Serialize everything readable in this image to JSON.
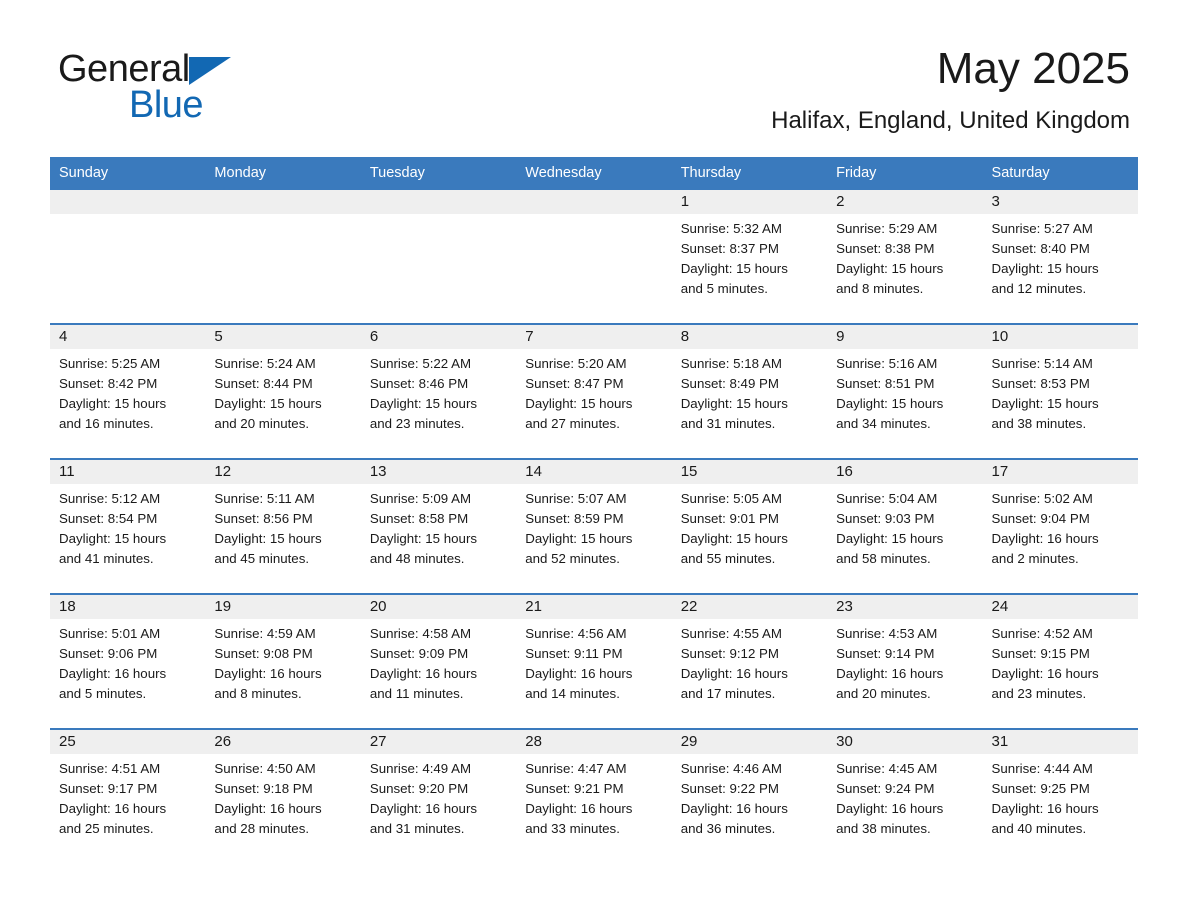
{
  "brand": {
    "name_part1": "General",
    "name_part2": "Blue",
    "accent_color": "#1268b3"
  },
  "header": {
    "month_title": "May 2025",
    "location": "Halifax, England, United Kingdom",
    "header_bg_color": "#3a7abd"
  },
  "labels": {
    "sunrise_prefix": "Sunrise:",
    "sunset_prefix": "Sunset:",
    "daylight_prefix": "Daylight:"
  },
  "weekdays": [
    "Sunday",
    "Monday",
    "Tuesday",
    "Wednesday",
    "Thursday",
    "Friday",
    "Saturday"
  ],
  "weeks": [
    [
      {
        "day": "",
        "sunrise": "",
        "sunset": "",
        "daylight_l1": "",
        "daylight_l2": "",
        "empty": true
      },
      {
        "day": "",
        "sunrise": "",
        "sunset": "",
        "daylight_l1": "",
        "daylight_l2": "",
        "empty": true
      },
      {
        "day": "",
        "sunrise": "",
        "sunset": "",
        "daylight_l1": "",
        "daylight_l2": "",
        "empty": true
      },
      {
        "day": "",
        "sunrise": "",
        "sunset": "",
        "daylight_l1": "",
        "daylight_l2": "",
        "empty": true
      },
      {
        "day": "1",
        "sunrise": "Sunrise: 5:32 AM",
        "sunset": "Sunset: 8:37 PM",
        "daylight_l1": "Daylight: 15 hours",
        "daylight_l2": "and 5 minutes.",
        "empty": false
      },
      {
        "day": "2",
        "sunrise": "Sunrise: 5:29 AM",
        "sunset": "Sunset: 8:38 PM",
        "daylight_l1": "Daylight: 15 hours",
        "daylight_l2": "and 8 minutes.",
        "empty": false
      },
      {
        "day": "3",
        "sunrise": "Sunrise: 5:27 AM",
        "sunset": "Sunset: 8:40 PM",
        "daylight_l1": "Daylight: 15 hours",
        "daylight_l2": "and 12 minutes.",
        "empty": false
      }
    ],
    [
      {
        "day": "4",
        "sunrise": "Sunrise: 5:25 AM",
        "sunset": "Sunset: 8:42 PM",
        "daylight_l1": "Daylight: 15 hours",
        "daylight_l2": "and 16 minutes.",
        "empty": false
      },
      {
        "day": "5",
        "sunrise": "Sunrise: 5:24 AM",
        "sunset": "Sunset: 8:44 PM",
        "daylight_l1": "Daylight: 15 hours",
        "daylight_l2": "and 20 minutes.",
        "empty": false
      },
      {
        "day": "6",
        "sunrise": "Sunrise: 5:22 AM",
        "sunset": "Sunset: 8:46 PM",
        "daylight_l1": "Daylight: 15 hours",
        "daylight_l2": "and 23 minutes.",
        "empty": false
      },
      {
        "day": "7",
        "sunrise": "Sunrise: 5:20 AM",
        "sunset": "Sunset: 8:47 PM",
        "daylight_l1": "Daylight: 15 hours",
        "daylight_l2": "and 27 minutes.",
        "empty": false
      },
      {
        "day": "8",
        "sunrise": "Sunrise: 5:18 AM",
        "sunset": "Sunset: 8:49 PM",
        "daylight_l1": "Daylight: 15 hours",
        "daylight_l2": "and 31 minutes.",
        "empty": false
      },
      {
        "day": "9",
        "sunrise": "Sunrise: 5:16 AM",
        "sunset": "Sunset: 8:51 PM",
        "daylight_l1": "Daylight: 15 hours",
        "daylight_l2": "and 34 minutes.",
        "empty": false
      },
      {
        "day": "10",
        "sunrise": "Sunrise: 5:14 AM",
        "sunset": "Sunset: 8:53 PM",
        "daylight_l1": "Daylight: 15 hours",
        "daylight_l2": "and 38 minutes.",
        "empty": false
      }
    ],
    [
      {
        "day": "11",
        "sunrise": "Sunrise: 5:12 AM",
        "sunset": "Sunset: 8:54 PM",
        "daylight_l1": "Daylight: 15 hours",
        "daylight_l2": "and 41 minutes.",
        "empty": false
      },
      {
        "day": "12",
        "sunrise": "Sunrise: 5:11 AM",
        "sunset": "Sunset: 8:56 PM",
        "daylight_l1": "Daylight: 15 hours",
        "daylight_l2": "and 45 minutes.",
        "empty": false
      },
      {
        "day": "13",
        "sunrise": "Sunrise: 5:09 AM",
        "sunset": "Sunset: 8:58 PM",
        "daylight_l1": "Daylight: 15 hours",
        "daylight_l2": "and 48 minutes.",
        "empty": false
      },
      {
        "day": "14",
        "sunrise": "Sunrise: 5:07 AM",
        "sunset": "Sunset: 8:59 PM",
        "daylight_l1": "Daylight: 15 hours",
        "daylight_l2": "and 52 minutes.",
        "empty": false
      },
      {
        "day": "15",
        "sunrise": "Sunrise: 5:05 AM",
        "sunset": "Sunset: 9:01 PM",
        "daylight_l1": "Daylight: 15 hours",
        "daylight_l2": "and 55 minutes.",
        "empty": false
      },
      {
        "day": "16",
        "sunrise": "Sunrise: 5:04 AM",
        "sunset": "Sunset: 9:03 PM",
        "daylight_l1": "Daylight: 15 hours",
        "daylight_l2": "and 58 minutes.",
        "empty": false
      },
      {
        "day": "17",
        "sunrise": "Sunrise: 5:02 AM",
        "sunset": "Sunset: 9:04 PM",
        "daylight_l1": "Daylight: 16 hours",
        "daylight_l2": "and 2 minutes.",
        "empty": false
      }
    ],
    [
      {
        "day": "18",
        "sunrise": "Sunrise: 5:01 AM",
        "sunset": "Sunset: 9:06 PM",
        "daylight_l1": "Daylight: 16 hours",
        "daylight_l2": "and 5 minutes.",
        "empty": false
      },
      {
        "day": "19",
        "sunrise": "Sunrise: 4:59 AM",
        "sunset": "Sunset: 9:08 PM",
        "daylight_l1": "Daylight: 16 hours",
        "daylight_l2": "and 8 minutes.",
        "empty": false
      },
      {
        "day": "20",
        "sunrise": "Sunrise: 4:58 AM",
        "sunset": "Sunset: 9:09 PM",
        "daylight_l1": "Daylight: 16 hours",
        "daylight_l2": "and 11 minutes.",
        "empty": false
      },
      {
        "day": "21",
        "sunrise": "Sunrise: 4:56 AM",
        "sunset": "Sunset: 9:11 PM",
        "daylight_l1": "Daylight: 16 hours",
        "daylight_l2": "and 14 minutes.",
        "empty": false
      },
      {
        "day": "22",
        "sunrise": "Sunrise: 4:55 AM",
        "sunset": "Sunset: 9:12 PM",
        "daylight_l1": "Daylight: 16 hours",
        "daylight_l2": "and 17 minutes.",
        "empty": false
      },
      {
        "day": "23",
        "sunrise": "Sunrise: 4:53 AM",
        "sunset": "Sunset: 9:14 PM",
        "daylight_l1": "Daylight: 16 hours",
        "daylight_l2": "and 20 minutes.",
        "empty": false
      },
      {
        "day": "24",
        "sunrise": "Sunrise: 4:52 AM",
        "sunset": "Sunset: 9:15 PM",
        "daylight_l1": "Daylight: 16 hours",
        "daylight_l2": "and 23 minutes.",
        "empty": false
      }
    ],
    [
      {
        "day": "25",
        "sunrise": "Sunrise: 4:51 AM",
        "sunset": "Sunset: 9:17 PM",
        "daylight_l1": "Daylight: 16 hours",
        "daylight_l2": "and 25 minutes.",
        "empty": false
      },
      {
        "day": "26",
        "sunrise": "Sunrise: 4:50 AM",
        "sunset": "Sunset: 9:18 PM",
        "daylight_l1": "Daylight: 16 hours",
        "daylight_l2": "and 28 minutes.",
        "empty": false
      },
      {
        "day": "27",
        "sunrise": "Sunrise: 4:49 AM",
        "sunset": "Sunset: 9:20 PM",
        "daylight_l1": "Daylight: 16 hours",
        "daylight_l2": "and 31 minutes.",
        "empty": false
      },
      {
        "day": "28",
        "sunrise": "Sunrise: 4:47 AM",
        "sunset": "Sunset: 9:21 PM",
        "daylight_l1": "Daylight: 16 hours",
        "daylight_l2": "and 33 minutes.",
        "empty": false
      },
      {
        "day": "29",
        "sunrise": "Sunrise: 4:46 AM",
        "sunset": "Sunset: 9:22 PM",
        "daylight_l1": "Daylight: 16 hours",
        "daylight_l2": "and 36 minutes.",
        "empty": false
      },
      {
        "day": "30",
        "sunrise": "Sunrise: 4:45 AM",
        "sunset": "Sunset: 9:24 PM",
        "daylight_l1": "Daylight: 16 hours",
        "daylight_l2": "and 38 minutes.",
        "empty": false
      },
      {
        "day": "31",
        "sunrise": "Sunrise: 4:44 AM",
        "sunset": "Sunset: 9:25 PM",
        "daylight_l1": "Daylight: 16 hours",
        "daylight_l2": "and 40 minutes.",
        "empty": false
      }
    ]
  ]
}
